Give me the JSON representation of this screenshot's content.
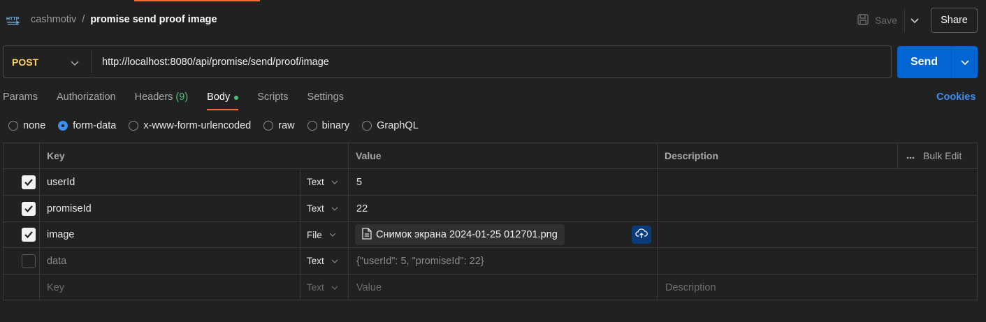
{
  "header": {
    "collection": "cashmotiv",
    "separator": "/",
    "request_name": "promise send proof image",
    "save_label": "Save",
    "share_label": "Share",
    "icons": {
      "request_type": "http-icon",
      "save": "save-icon",
      "caret": "chevron-down-icon"
    }
  },
  "urlbar": {
    "method": "POST",
    "url": "http://localhost:8080/api/promise/send/proof/image",
    "send_label": "Send"
  },
  "tabs": [
    {
      "label": "Params"
    },
    {
      "label": "Authorization"
    },
    {
      "label": "Headers",
      "count": "(9)"
    },
    {
      "label": "Body",
      "active": true
    },
    {
      "label": "Scripts"
    },
    {
      "label": "Settings"
    }
  ],
  "cookies_label": "Cookies",
  "body_types": [
    {
      "label": "none"
    },
    {
      "label": "form-data",
      "selected": true
    },
    {
      "label": "x-www-form-urlencoded"
    },
    {
      "label": "raw"
    },
    {
      "label": "binary"
    },
    {
      "label": "GraphQL"
    }
  ],
  "table": {
    "headers": {
      "key": "Key",
      "value": "Value",
      "description": "Description",
      "bulk_edit": "Bulk Edit"
    },
    "rows": [
      {
        "enabled": true,
        "key": "userId",
        "type": "Text",
        "value": "5",
        "description": ""
      },
      {
        "enabled": true,
        "key": "promiseId",
        "type": "Text",
        "value": "22",
        "description": ""
      },
      {
        "enabled": true,
        "key": "image",
        "type": "File",
        "value": "Снимок экрана 2024-01-25 012701.png",
        "description": ""
      },
      {
        "enabled": false,
        "key": "data",
        "type": "Text",
        "value": "{\"userId\": 5, \"promiseId\": 22}",
        "description": ""
      }
    ],
    "new_row": {
      "key_placeholder": "Key",
      "type": "Text",
      "value_placeholder": "Value",
      "description_placeholder": "Description"
    }
  },
  "colors": {
    "accent": "#ff6c37",
    "send_blue": "#0265d2",
    "method_post": "#ffd665",
    "link_blue": "#3b8ef0",
    "success_green": "#4ac17b",
    "background": "#212121"
  }
}
